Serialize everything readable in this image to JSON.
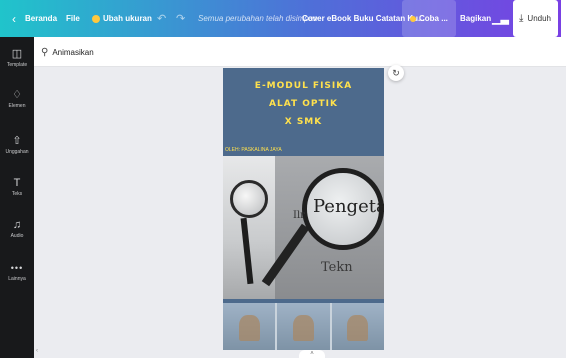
{
  "topbar": {
    "back_icon": "chevron-left-icon",
    "home_label": "Beranda",
    "file_label": "File",
    "resize_label": "Ubah ukuran",
    "undo_icon": "undo-icon",
    "redo_icon": "redo-icon",
    "save_status": "Semua perubahan telah disimpan",
    "document_title": "Cover eBook Buku Catatan Ku...",
    "try_label": "Coba ...",
    "share_label": "Bagikan",
    "insights_icon": "bar-chart-icon",
    "download_label": "Unduh"
  },
  "sidebar": {
    "items": [
      {
        "label": "Template",
        "icon": "template-icon"
      },
      {
        "label": "Elemen",
        "icon": "shapes-icon"
      },
      {
        "label": "Unggahan",
        "icon": "upload-icon"
      },
      {
        "label": "Teks",
        "icon": "text-icon"
      },
      {
        "label": "Audio",
        "icon": "music-icon"
      },
      {
        "label": "Lainnya",
        "icon": "more-icon"
      }
    ]
  },
  "contextbar": {
    "animate_label": "Animasikan"
  },
  "page": {
    "title_line1": "E-MODUL FISIKA",
    "title_line2": "ALAT OPTIK",
    "title_line3": "X SMK",
    "author": "OLEH: PASKALINA JAYA",
    "photo_text_main": "Pengeta",
    "photo_text_small": "Ilr",
    "photo_text_bottom": "Tekn"
  },
  "colors": {
    "topbar_start": "#20c4cb",
    "topbar_end": "#7a3fe4",
    "sidebar_bg": "#18191b",
    "page_bg": "#4d6a8c",
    "title_color": "#ffe14d"
  }
}
